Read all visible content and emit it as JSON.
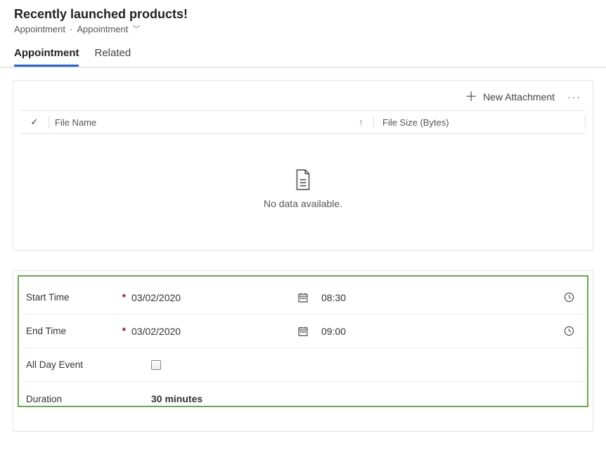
{
  "header": {
    "title": "Recently launched products!",
    "breadcrumb_entity": "Appointment",
    "breadcrumb_sep": "·",
    "breadcrumb_type": "Appointment"
  },
  "tabs": {
    "appointment": "Appointment",
    "related": "Related"
  },
  "attachments": {
    "new_label": "New Attachment",
    "more": "···",
    "col_filename": "File Name",
    "col_filesize": "File Size (Bytes)",
    "empty": "No data available."
  },
  "form": {
    "start_time": {
      "label": "Start Time",
      "date": "03/02/2020",
      "time": "08:30"
    },
    "end_time": {
      "label": "End Time",
      "date": "03/02/2020",
      "time": "09:00"
    },
    "all_day": {
      "label": "All Day Event"
    },
    "duration": {
      "label": "Duration",
      "value": "30 minutes"
    }
  }
}
